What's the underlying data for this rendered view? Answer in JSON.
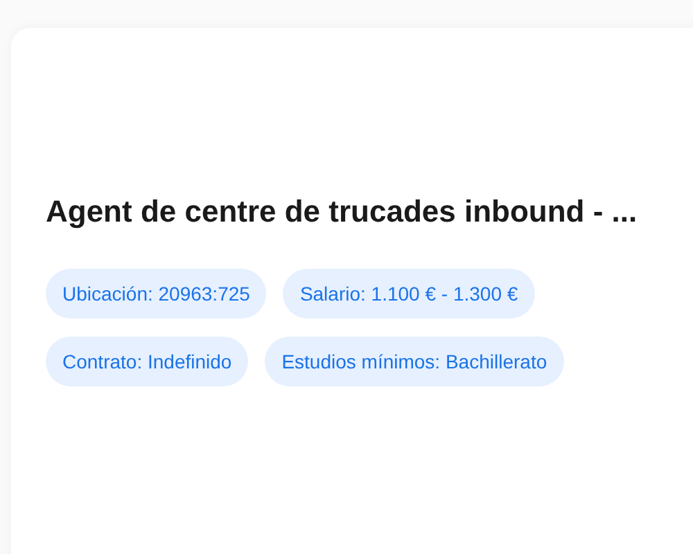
{
  "job_card": {
    "title": "Agent de centre de trucades inbound - ...",
    "tags": [
      {
        "label": "Ubicación: 20963:725"
      },
      {
        "label": "Salario: 1.100 € - 1.300 €"
      },
      {
        "label": "Contrato: Indefinido"
      },
      {
        "label": "Estudios mínimos: Bachillerato"
      }
    ]
  }
}
